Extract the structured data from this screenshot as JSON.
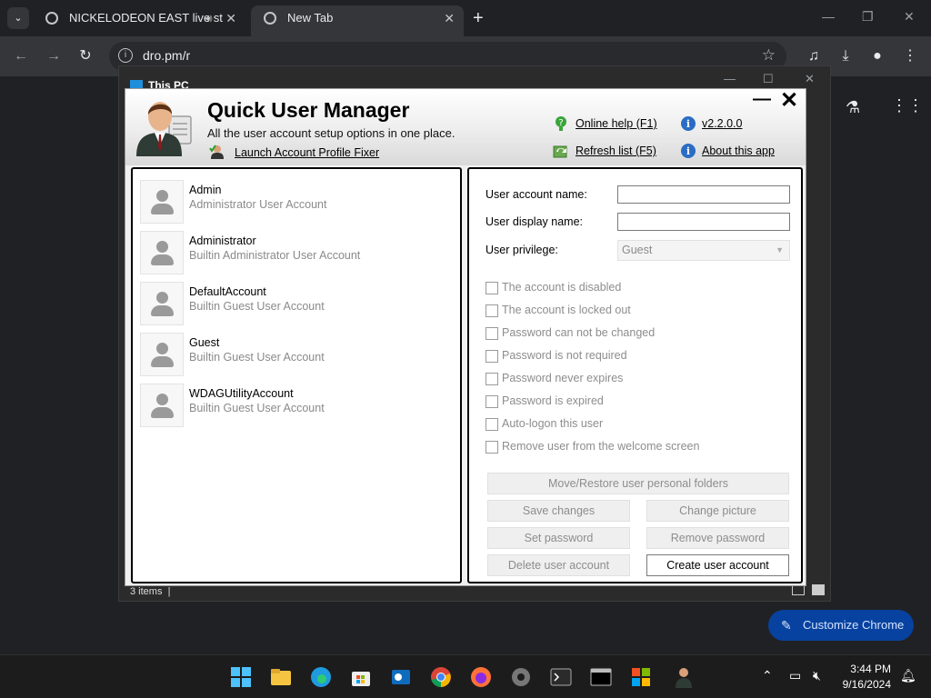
{
  "chrome": {
    "tabs": [
      {
        "title": "NICKELODEON EAST live st",
        "active": false
      },
      {
        "title": "New Tab",
        "active": true
      }
    ],
    "url": "dro.pm/r",
    "customize_label": "Customize Chrome"
  },
  "explorer": {
    "title": "This PC",
    "status": "3 items"
  },
  "qum": {
    "title": "Quick User Manager",
    "subtitle": "All the user account setup options in one place.",
    "launch_fixer": "Launch Account Profile Fixer",
    "online_help": "Online help (F1)",
    "refresh": "Refresh list (F5)",
    "version": "v2.2.0.0",
    "about": "About this app",
    "users": [
      {
        "name": "Admin",
        "desc": "Administrator User Account"
      },
      {
        "name": "Administrator",
        "desc": "Builtin Administrator User Account"
      },
      {
        "name": "DefaultAccount",
        "desc": "Builtin Guest User Account"
      },
      {
        "name": "Guest",
        "desc": "Builtin Guest User Account"
      },
      {
        "name": "WDAGUtilityAccount",
        "desc": "Builtin Guest User Account"
      }
    ],
    "form": {
      "account_name_label": "User account name:",
      "account_name_value": "",
      "display_name_label": "User display name:",
      "display_name_value": "",
      "privilege_label": "User privilege:",
      "privilege_value": "Guest"
    },
    "options": [
      "The account is disabled",
      "The account is locked out",
      "Password can not be changed",
      "Password is not required",
      "Password never expires",
      "Password is expired",
      "Auto-logon this user",
      "Remove user from the welcome screen"
    ],
    "buttons": {
      "move_restore": "Move/Restore user personal folders",
      "save": "Save changes",
      "change_picture": "Change picture",
      "set_password": "Set password",
      "remove_password": "Remove password",
      "delete": "Delete user account",
      "create": "Create user account"
    }
  },
  "taskbar": {
    "time": "3:44 PM",
    "date": "9/16/2024"
  }
}
